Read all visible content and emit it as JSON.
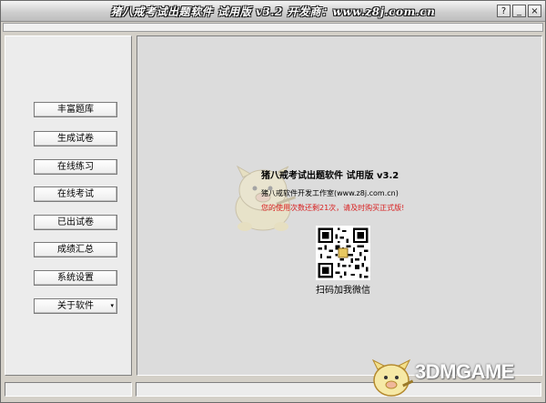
{
  "window": {
    "title": "猪八戒考试出题软件 试用版 v3.2 开发商：www.z8j.com.cn",
    "controls": {
      "help": "?",
      "minimize": "_",
      "close": "×"
    }
  },
  "sidebar": {
    "items": [
      {
        "label": "丰富题库"
      },
      {
        "label": "生成试卷"
      },
      {
        "label": "在线练习"
      },
      {
        "label": "在线考试"
      },
      {
        "label": "已出试卷"
      },
      {
        "label": "成绩汇总"
      },
      {
        "label": "系统设置"
      },
      {
        "label": "关于软件",
        "dropdown_arrow": "▾"
      }
    ]
  },
  "main": {
    "product_title": "猪八戒考试出题软件 试用版 v3.2",
    "vendor_text": "猪八戒软件开发工作室(www.z8j.com.cn)",
    "trial_warning": "您的使用次数还剩21次，请及时购买正式版!",
    "qr_caption": "扫码加我微信"
  },
  "watermark": {
    "text": "3DMGAME"
  },
  "colors": {
    "warning": "#d81f1f",
    "window_bg": "#d4d0c8",
    "panel_bg": "#dcdcdc"
  },
  "icons": [
    "pig-mascot-icon",
    "qr-code-icon",
    "pig-logo-icon",
    "help-icon",
    "minimize-icon",
    "close-icon",
    "chevron-down-icon"
  ]
}
